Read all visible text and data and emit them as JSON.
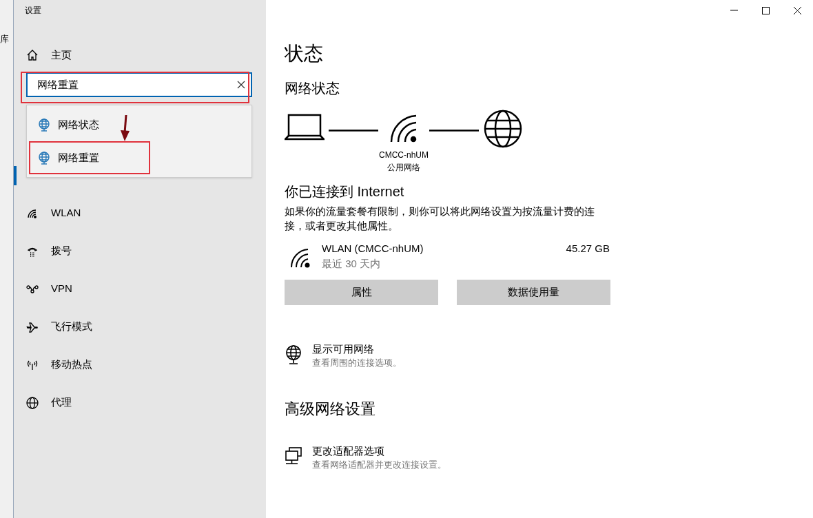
{
  "background_window": {
    "label": "库"
  },
  "window": {
    "title": "设置"
  },
  "sidebar": {
    "home": "主页",
    "search": {
      "value": "网络重置",
      "focused": true
    },
    "suggestions": [
      {
        "label": "网络状态",
        "highlighted": false
      },
      {
        "label": "网络重置",
        "highlighted": true
      }
    ],
    "items": [
      {
        "selected": true
      },
      {
        "kind": "wifi",
        "label": "WLAN",
        "selected": false
      },
      {
        "kind": "dialup",
        "label": "拨号",
        "selected": false
      },
      {
        "kind": "vpn",
        "label": "VPN",
        "selected": false
      },
      {
        "kind": "airplane",
        "label": "飞行模式",
        "selected": false
      },
      {
        "kind": "hotspot",
        "label": "移动热点",
        "selected": false
      },
      {
        "kind": "proxy",
        "label": "代理",
        "selected": false
      }
    ]
  },
  "main": {
    "title": "状态",
    "section": "网络状态",
    "diagram": {
      "network_name": "CMCC-nhUM",
      "network_type": "公用网络"
    },
    "connected": "你已连接到 Internet",
    "description": "如果你的流量套餐有限制，则你可以将此网络设置为按流量计费的连接，或者更改其他属性。",
    "connection": {
      "name": "WLAN (CMCC-nhUM)",
      "period": "最近 30 天内",
      "usage": "45.27 GB"
    },
    "buttons": [
      "属性",
      "数据使用量"
    ],
    "show_networks": {
      "title": "显示可用网络",
      "subtitle": "查看周围的连接选项。"
    },
    "advanced_title": "高级网络设置",
    "adapter": {
      "title": "更改适配器选项",
      "subtitle": "查看网络适配器并更改连接设置。"
    }
  }
}
